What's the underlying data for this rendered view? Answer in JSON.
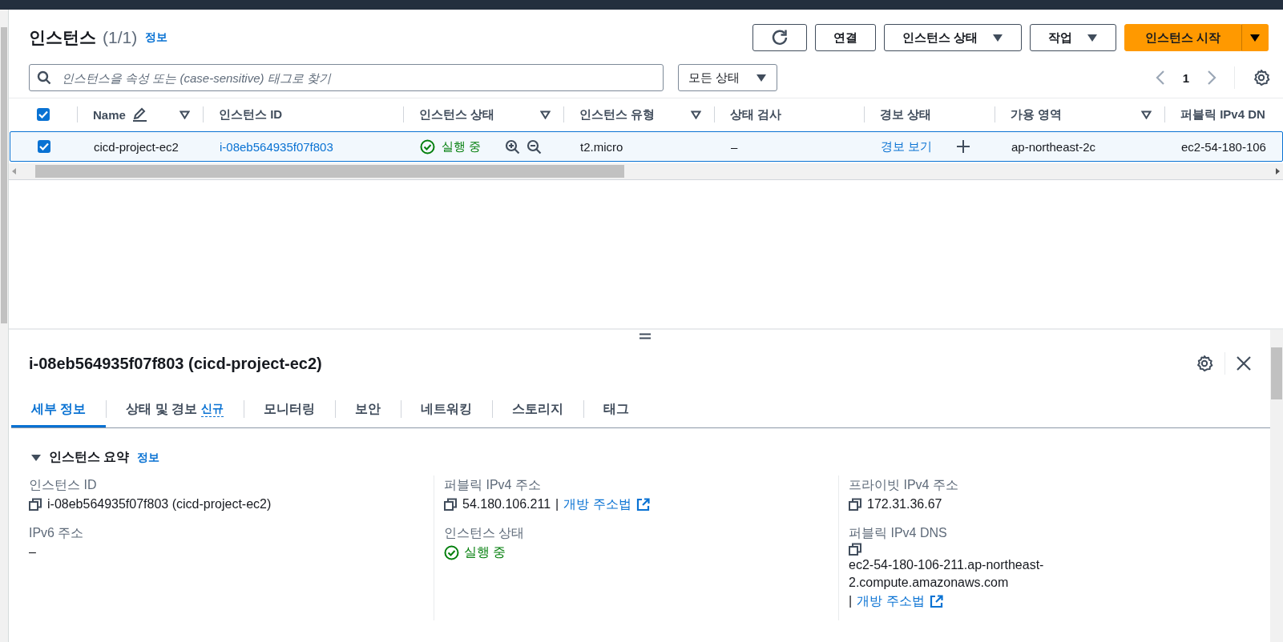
{
  "header": {
    "title": "인스턴스",
    "count": "(1/1)",
    "info": "정보"
  },
  "toolbar": {
    "buttons": [
      {
        "kind": "refresh"
      },
      {
        "kind": "plain",
        "label": "연결"
      },
      {
        "kind": "dropdown",
        "label": "인스턴스 상태"
      },
      {
        "kind": "dropdown",
        "label": "작업"
      },
      {
        "kind": "primary",
        "label": "인스턴스 시작"
      }
    ]
  },
  "search": {
    "placeholder": "인스턴스을 속성 또는 (case-sensitive) 태그로 찾기"
  },
  "filter": {
    "label": "모든 상태"
  },
  "pagination": {
    "page": "1"
  },
  "table": {
    "select_all": true,
    "columns": [
      {
        "label": "Name",
        "editable": true,
        "sortable": true
      },
      {
        "label": "인스턴스 ID",
        "editable": false,
        "sortable": false
      },
      {
        "label": "인스턴스 상태",
        "editable": false,
        "sortable": true
      },
      {
        "label": "인스턴스 유형",
        "editable": false,
        "sortable": true
      },
      {
        "label": "상태 검사",
        "editable": false,
        "sortable": false
      },
      {
        "label": "경보 상태",
        "editable": false,
        "sortable": false
      },
      {
        "label": "가용 영역",
        "editable": false,
        "sortable": true
      },
      {
        "label": "퍼블릭 IPv4 DN",
        "editable": false,
        "sortable": false
      }
    ],
    "rows": [
      {
        "selected": true,
        "cells": [
          {
            "kind": "text",
            "text": "cicd-project-ec2"
          },
          {
            "kind": "link",
            "text": "i-08eb564935f07f803"
          },
          {
            "kind": "status",
            "text": "실행 중"
          },
          {
            "kind": "text",
            "text": "t2.micro"
          },
          {
            "kind": "text",
            "text": "–"
          },
          {
            "kind": "alarm",
            "text": "경보 보기"
          },
          {
            "kind": "text",
            "text": "ap-northeast-2c"
          },
          {
            "kind": "text",
            "text": "ec2-54-180-106"
          }
        ]
      }
    ]
  },
  "details": {
    "title": "i-08eb564935f07f803 (cicd-project-ec2)",
    "tabs": [
      {
        "label": "세부 정보",
        "selected": true
      },
      {
        "label": "상태 및 경보",
        "badge": "신규",
        "selected": false
      },
      {
        "label": "모니터링",
        "selected": false
      },
      {
        "label": "보안",
        "selected": false
      },
      {
        "label": "네트워킹",
        "selected": false
      },
      {
        "label": "스토리지",
        "selected": false
      },
      {
        "label": "태그",
        "selected": false
      }
    ],
    "section": {
      "title": "인스턴스 요약",
      "info": "정보",
      "expanded": true
    },
    "columns": [
      [
        {
          "kind": "copy",
          "label": "인스턴스 ID",
          "value": "i-08eb564935f07f803 (cicd-project-ec2)"
        },
        {
          "kind": "text",
          "label": "IPv6 주소",
          "value": "–"
        }
      ],
      [
        {
          "kind": "copy",
          "label": "퍼블릭 IPv4 주소",
          "value": "54.180.106.211",
          "separator": "|",
          "link": "개방 주소법"
        },
        {
          "kind": "status",
          "label": "인스턴스 상태",
          "value": "실행 중"
        }
      ],
      [
        {
          "kind": "copy",
          "label": "프라이빗 IPv4 주소",
          "value": "172.31.36.67"
        },
        {
          "kind": "block",
          "label": "퍼블릭 IPv4 DNS",
          "value": "ec2-54-180-106-211.ap-northeast-2.compute.amazonaws.com",
          "separator": "|",
          "link": "개방 주소법"
        }
      ]
    ]
  }
}
